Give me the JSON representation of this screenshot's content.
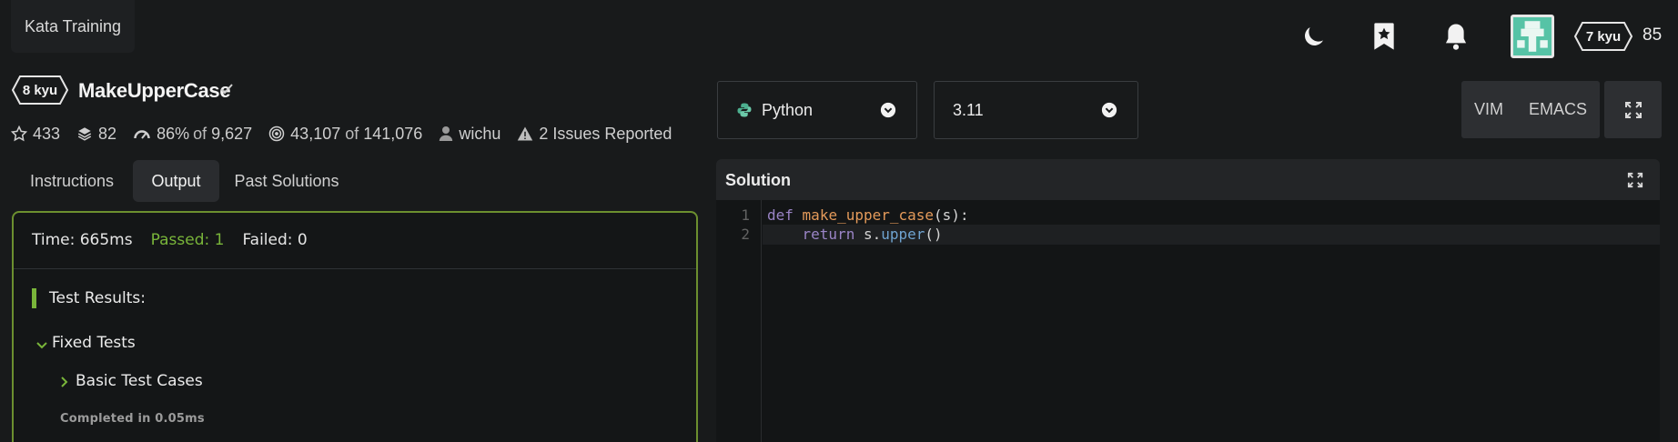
{
  "topbar": {
    "kata_training_label": "Kata Training",
    "user_rank_label": "7 kyu",
    "honor": "85"
  },
  "kata": {
    "rank_label": "8 kyu",
    "title": "MakeUpperCase",
    "stats": {
      "stars": "433",
      "collections": "82",
      "satisfaction": "86%",
      "satisfaction_of": "of",
      "satisfaction_votes": "9,627",
      "completed": "43,107",
      "completed_of": "of",
      "attempted": "141,076",
      "author": "wichu",
      "issues": "2 Issues Reported"
    }
  },
  "tabs": [
    {
      "label": "Instructions",
      "active": false
    },
    {
      "label": "Output",
      "active": true
    },
    {
      "label": "Past Solutions",
      "active": false
    }
  ],
  "output": {
    "time": "Time: 665ms",
    "passed": "Passed: 1",
    "failed": "Failed: 0",
    "results_title": "Test Results:",
    "fixed_tests": "Fixed Tests",
    "basic_test_cases": "Basic Test Cases",
    "completed_in": "Completed in 0.05ms"
  },
  "editor_controls": {
    "language": "Python",
    "version": "3.11",
    "vim_label": "VIM",
    "emacs_label": "EMACS"
  },
  "solution": {
    "title": "Solution",
    "line_numbers": [
      "1",
      "2"
    ],
    "code": {
      "line1_kw": "def",
      "line1_fn": "make_upper_case",
      "line1_rest": "(s):",
      "line2_indent": "    ",
      "line2_kw": "return",
      "line2_obj": " s.",
      "line2_meth": "upper",
      "line2_rest": "()"
    }
  },
  "colors": {
    "background": "#181a1b",
    "passed_green": "#79b53a",
    "output_border": "#6c8f2f",
    "keyword": "#9a84c6",
    "function_name": "#e49a5a",
    "method": "#6fa3d0"
  }
}
